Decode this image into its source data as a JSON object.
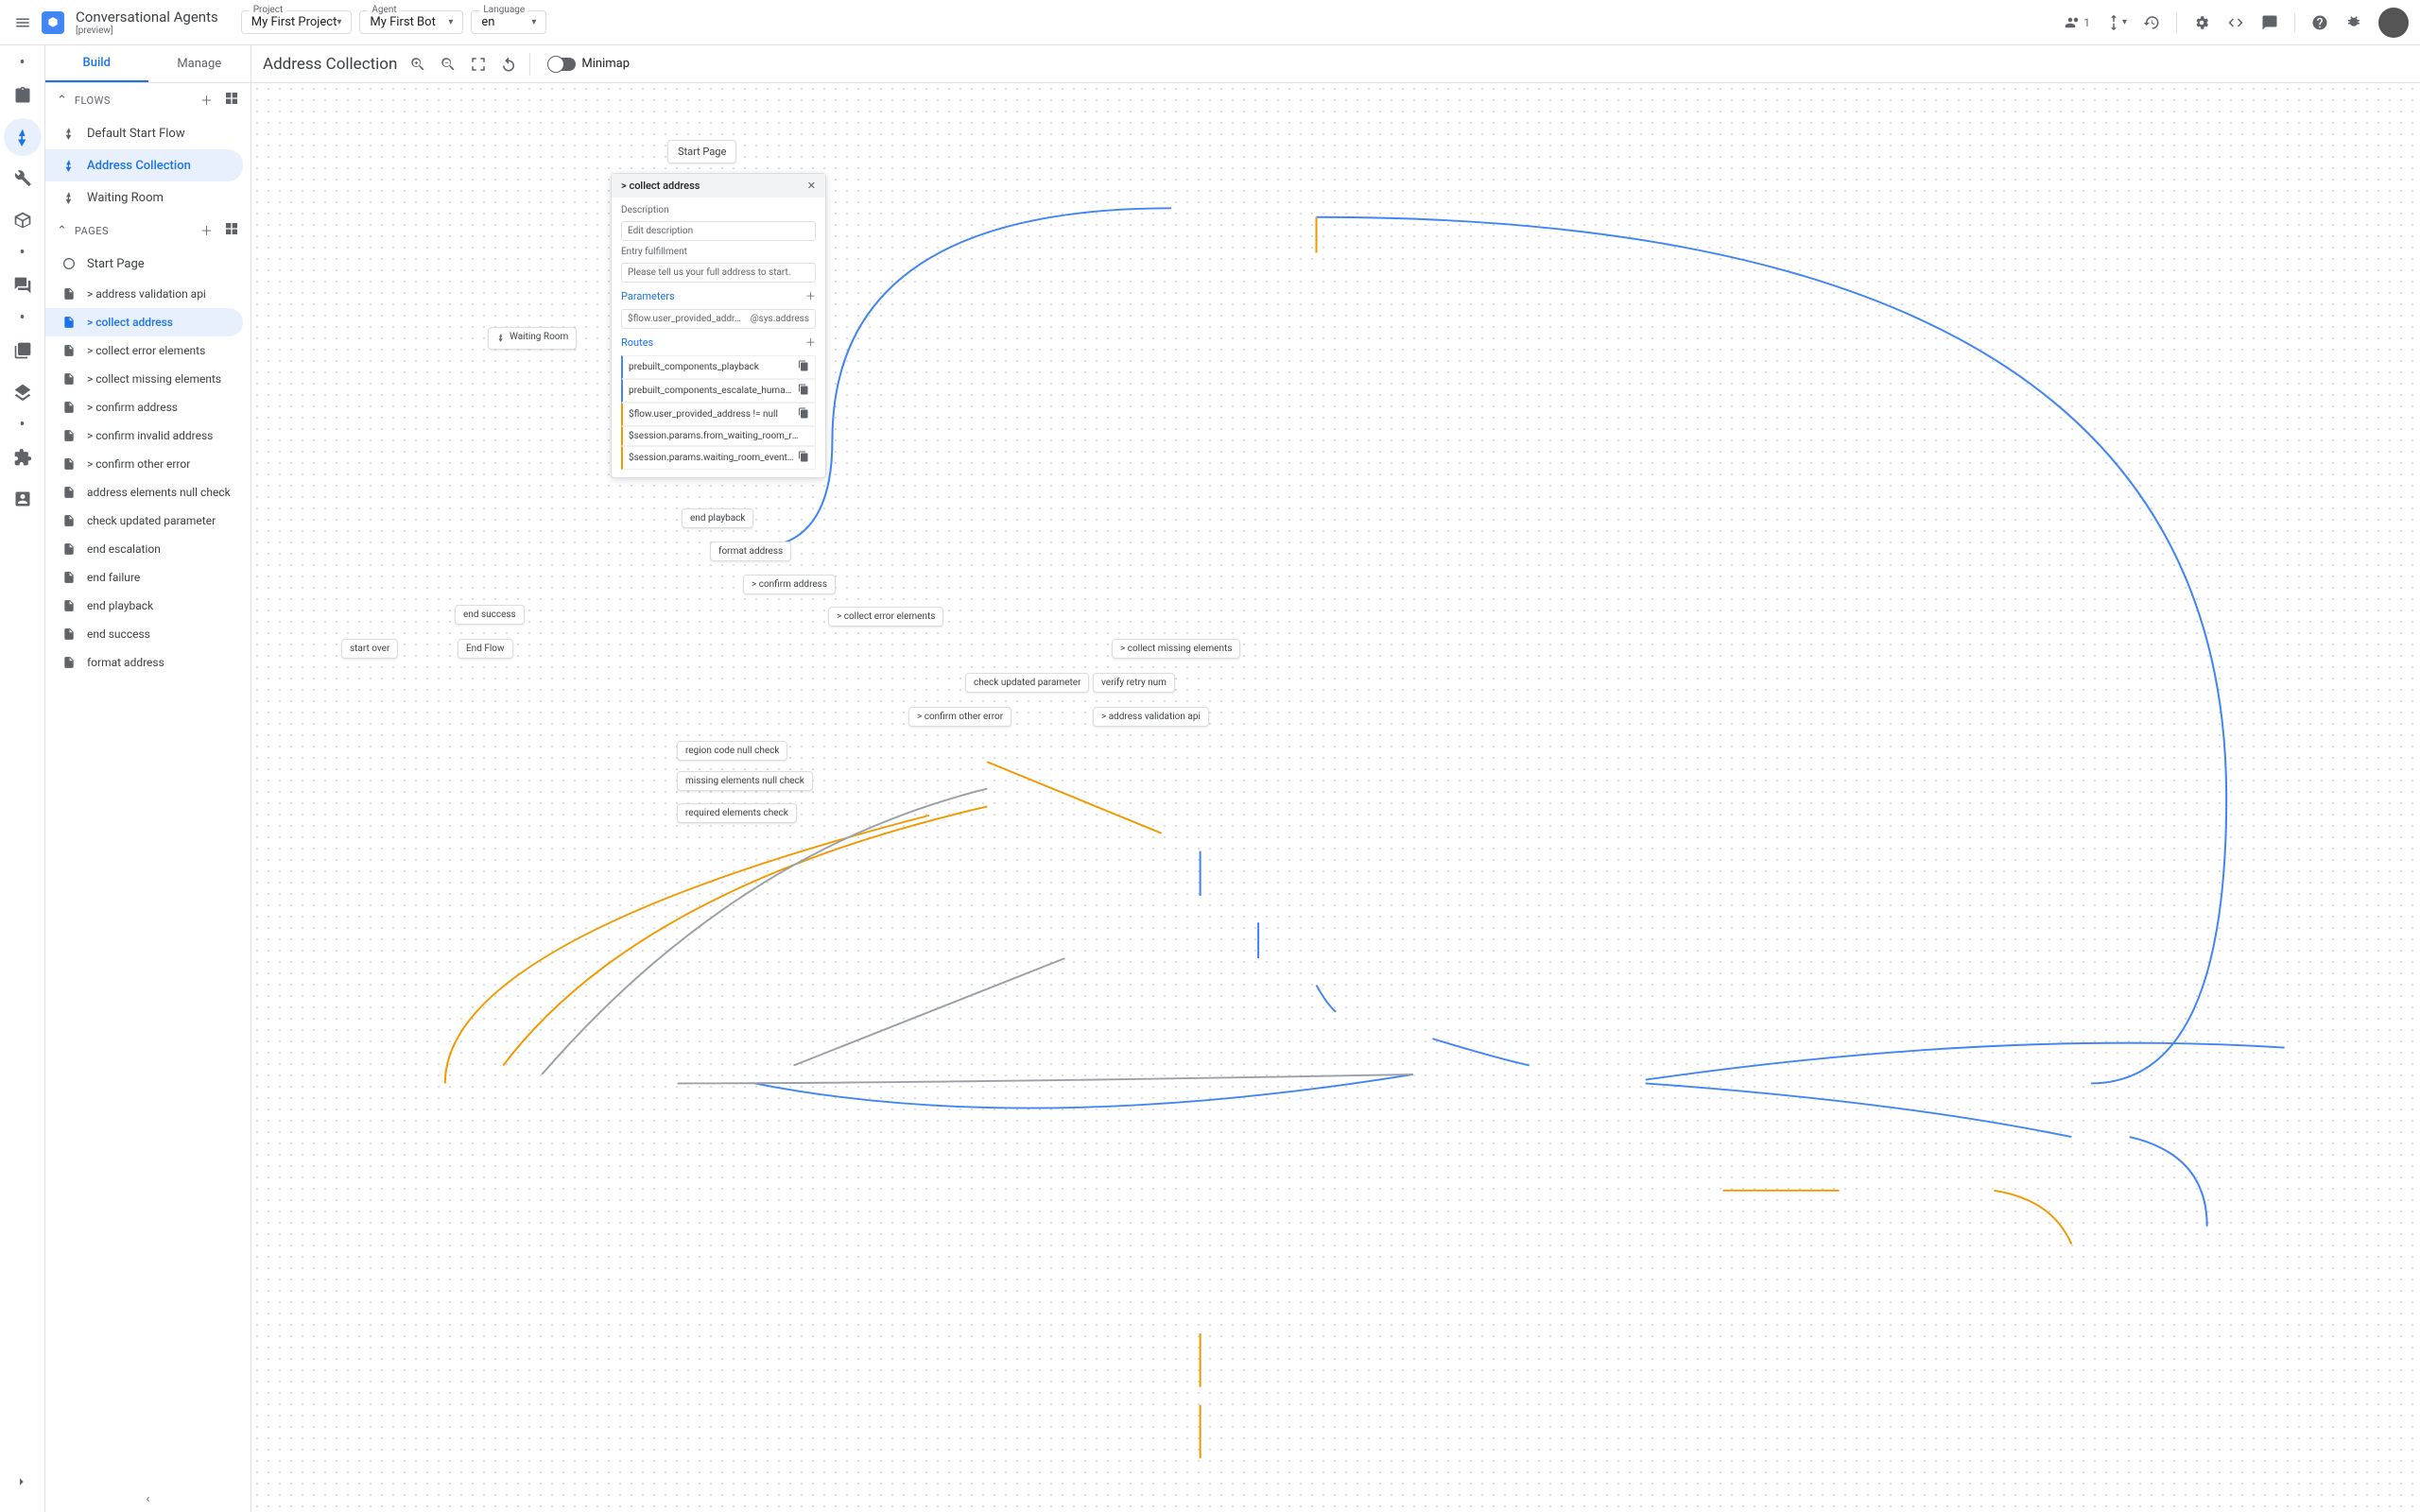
{
  "header": {
    "title": "Conversational Agents",
    "subtitle": "[preview]",
    "project_label": "Project",
    "project_value": "My First Project",
    "agent_label": "Agent",
    "agent_value": "My First Bot",
    "lang_label": "Language",
    "lang_value": "en",
    "users_count": "1"
  },
  "tabs": {
    "build": "Build",
    "manage": "Manage"
  },
  "flows": {
    "heading": "FLOWS",
    "items": [
      "Default Start Flow",
      "Address Collection",
      "Waiting Room"
    ],
    "selected": 1
  },
  "pages": {
    "heading": "PAGES",
    "start": "Start Page",
    "items": [
      "> address validation api",
      "> collect address",
      "> collect error elements",
      "> collect missing elements",
      "> confirm address",
      "> confirm invalid address",
      "> confirm other error",
      "address elements null check",
      "check updated parameter",
      "end escalation",
      "end failure",
      "end playback",
      "end success",
      "format address"
    ],
    "selected": 1
  },
  "toolbar": {
    "crumb": "Address Collection",
    "minimap": "Minimap"
  },
  "popup": {
    "title": "> collect address",
    "desc_label": "Description",
    "desc_placeholder": "Edit description",
    "entry_label": "Entry fulfillment",
    "entry_value": "Please tell us your full address to start.",
    "params_label": "Parameters",
    "param_name": "$flow.user_provided_addr…",
    "param_type": "@sys.address",
    "routes_label": "Routes",
    "routes": [
      {
        "label": "prebuilt_components_playback",
        "color": "blue",
        "copy": true
      },
      {
        "label": "prebuilt_components_escalate_human_agent",
        "color": "blue",
        "copy": true
      },
      {
        "label": "$flow.user_provided_address != null",
        "color": "orange",
        "copy": true
      },
      {
        "label": "$session.params.from_waiting_room_reusable_fl…",
        "color": "orange",
        "copy": false
      },
      {
        "label": "$session.params.waiting_room_event_handl…",
        "color": "orange",
        "copy": true
      }
    ]
  },
  "canvas_nodes": {
    "start_page": "Start Page",
    "waiting_room": "Waiting Room",
    "end_playback": "end playback",
    "format_address": "format address",
    "confirm_address": "> confirm address",
    "collect_error": "> collect error elements",
    "end_success": "end success",
    "start_over": "start over",
    "end_flow": "End Flow",
    "collect_missing": "> collect missing elements",
    "check_updated": "check updated parameter",
    "verify_retry": "verify retry num",
    "confirm_other": "> confirm other error",
    "address_validation": "> address validation api",
    "region_check": "region code null check",
    "missing_check": "missing elements null check",
    "required_check": "required elements check"
  }
}
